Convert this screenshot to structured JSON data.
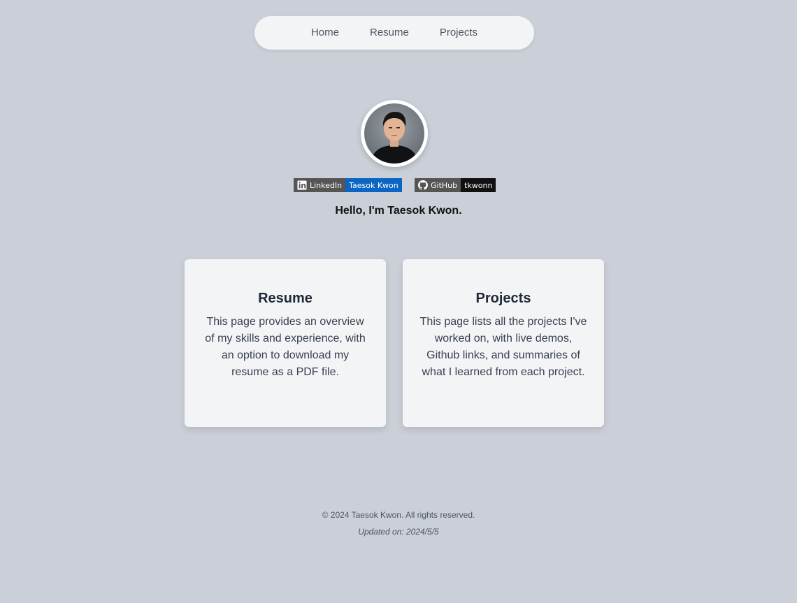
{
  "nav": {
    "items": [
      {
        "label": "Home"
      },
      {
        "label": "Resume"
      },
      {
        "label": "Projects"
      }
    ]
  },
  "profile": {
    "greeting": "Hello, I'm Taesok Kwon."
  },
  "badges": {
    "linkedin": {
      "label": "LinkedIn",
      "value": "Taesok Kwon",
      "color": "#0a66c2",
      "icon": "linkedin-icon"
    },
    "github": {
      "label": "GitHub",
      "value": "tkwonn",
      "color": "#111111",
      "icon": "github-icon"
    }
  },
  "cards": [
    {
      "title": "Resume",
      "description": "This page provides an overview of my skills and experience, with an option to download my resume as a PDF file."
    },
    {
      "title": "Projects",
      "description": "This page lists all the projects I've worked on, with live demos, Github links, and summaries of what I learned from each project."
    }
  ],
  "footer": {
    "copyright": "© 2024 Taesok Kwon. All rights reserved.",
    "updated": "Updated on: 2024/5/5"
  },
  "colors": {
    "background": "#cbd0d8",
    "surface": "#f3f4f6"
  }
}
